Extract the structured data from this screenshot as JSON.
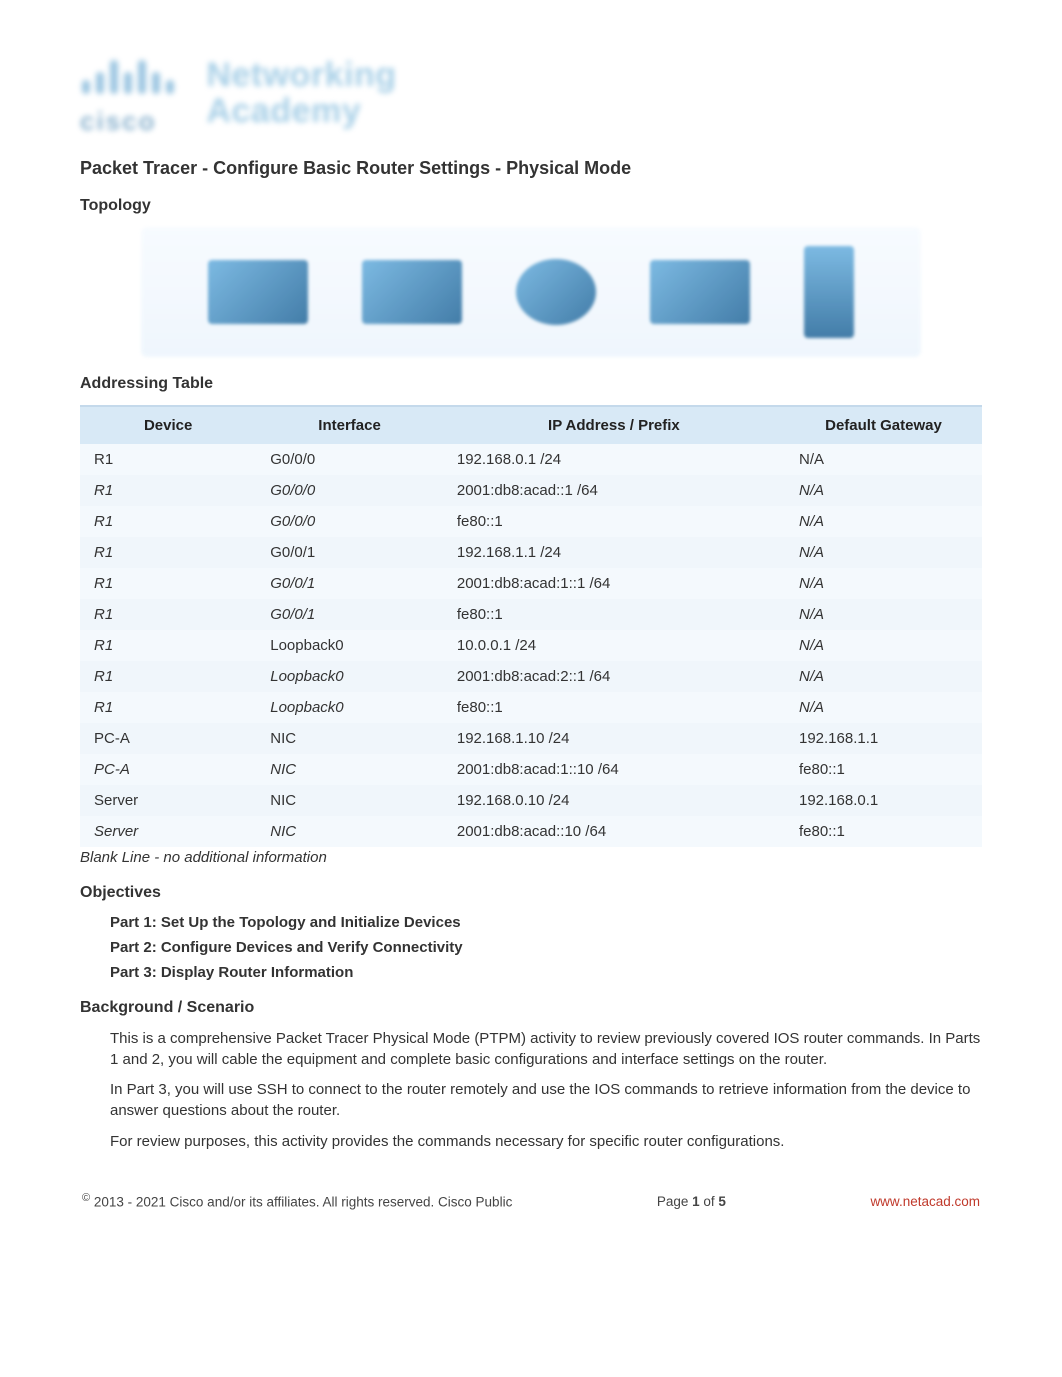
{
  "logo": {
    "brand": "cisco",
    "line1": "Networking",
    "line2": "Academy"
  },
  "title": "Packet Tracer - Configure Basic Router Settings - Physical Mode",
  "sections": {
    "topology": "Topology",
    "addressing": "Addressing Table",
    "objectives": "Objectives",
    "background": "Background / Scenario"
  },
  "table": {
    "headers": {
      "device": "Device",
      "iface": "Interface",
      "ip": "IP Address / Prefix",
      "gw": "Default Gateway"
    },
    "rows": [
      {
        "device": "R1",
        "device_italic": false,
        "iface": "G0/0/0",
        "iface_italic": false,
        "ip": "192.168.0.1 /24",
        "gw": "N/A",
        "gw_italic": false
      },
      {
        "device": "R1",
        "device_italic": true,
        "iface": "G0/0/0",
        "iface_italic": true,
        "ip": "2001:db8:acad::1 /64",
        "gw": "N/A",
        "gw_italic": true
      },
      {
        "device": "R1",
        "device_italic": true,
        "iface": "G0/0/0",
        "iface_italic": true,
        "ip": "fe80::1",
        "gw": "N/A",
        "gw_italic": true
      },
      {
        "device": "R1",
        "device_italic": true,
        "iface": "G0/0/1",
        "iface_italic": false,
        "ip": "192.168.1.1 /24",
        "gw": "N/A",
        "gw_italic": true
      },
      {
        "device": "R1",
        "device_italic": true,
        "iface": "G0/0/1",
        "iface_italic": true,
        "ip": "2001:db8:acad:1::1 /64",
        "gw": "N/A",
        "gw_italic": true
      },
      {
        "device": "R1",
        "device_italic": true,
        "iface": "G0/0/1",
        "iface_italic": true,
        "ip": "fe80::1",
        "gw": "N/A",
        "gw_italic": true
      },
      {
        "device": "R1",
        "device_italic": true,
        "iface": "Loopback0",
        "iface_italic": false,
        "ip": "10.0.0.1 /24",
        "gw": "N/A",
        "gw_italic": true
      },
      {
        "device": "R1",
        "device_italic": true,
        "iface": "Loopback0",
        "iface_italic": true,
        "ip": "2001:db8:acad:2::1 /64",
        "gw": "N/A",
        "gw_italic": true
      },
      {
        "device": "R1",
        "device_italic": true,
        "iface": "Loopback0",
        "iface_italic": true,
        "ip": "fe80::1",
        "gw": "N/A",
        "gw_italic": true
      },
      {
        "device": "PC-A",
        "device_italic": false,
        "iface": "NIC",
        "iface_italic": false,
        "ip": "192.168.1.10 /24",
        "gw": "192.168.1.1",
        "gw_italic": false
      },
      {
        "device": "PC-A",
        "device_italic": true,
        "iface": "NIC",
        "iface_italic": true,
        "ip": "2001:db8:acad:1::10 /64",
        "gw": "fe80::1",
        "gw_italic": false
      },
      {
        "device": "Server",
        "device_italic": false,
        "iface": "NIC",
        "iface_italic": false,
        "ip": "192.168.0.10 /24",
        "gw": "192.168.0.1",
        "gw_italic": false
      },
      {
        "device": "Server",
        "device_italic": true,
        "iface": "NIC",
        "iface_italic": true,
        "ip": "2001:db8:acad::10 /64",
        "gw": "fe80::1",
        "gw_italic": false
      }
    ],
    "blank_note": "Blank Line - no additional information"
  },
  "objectives": [
    "Part 1: Set Up the Topology and Initialize Devices",
    "Part 2: Configure Devices and Verify Connectivity",
    "Part 3: Display Router Information"
  ],
  "background_paras": [
    "This is a comprehensive Packet Tracer Physical Mode (PTPM) activity to review previously covered IOS router commands. In Parts 1 and 2, you will cable the equipment and complete basic configurations and interface settings on the router.",
    "In Part 3, you will use SSH to connect to the router remotely and use the IOS commands to retrieve information from the device to answer questions about the router.",
    "For review purposes, this activity provides the commands necessary for specific router configurations."
  ],
  "footer": {
    "copy_symbol": "©",
    "copyright": " 2013 - 2021 Cisco and/or its affiliates. All rights reserved. Cisco Public",
    "page_label_pre": "Page ",
    "page_current": "1",
    "page_label_mid": " of ",
    "page_total": "5",
    "link": "www.netacad.com"
  }
}
